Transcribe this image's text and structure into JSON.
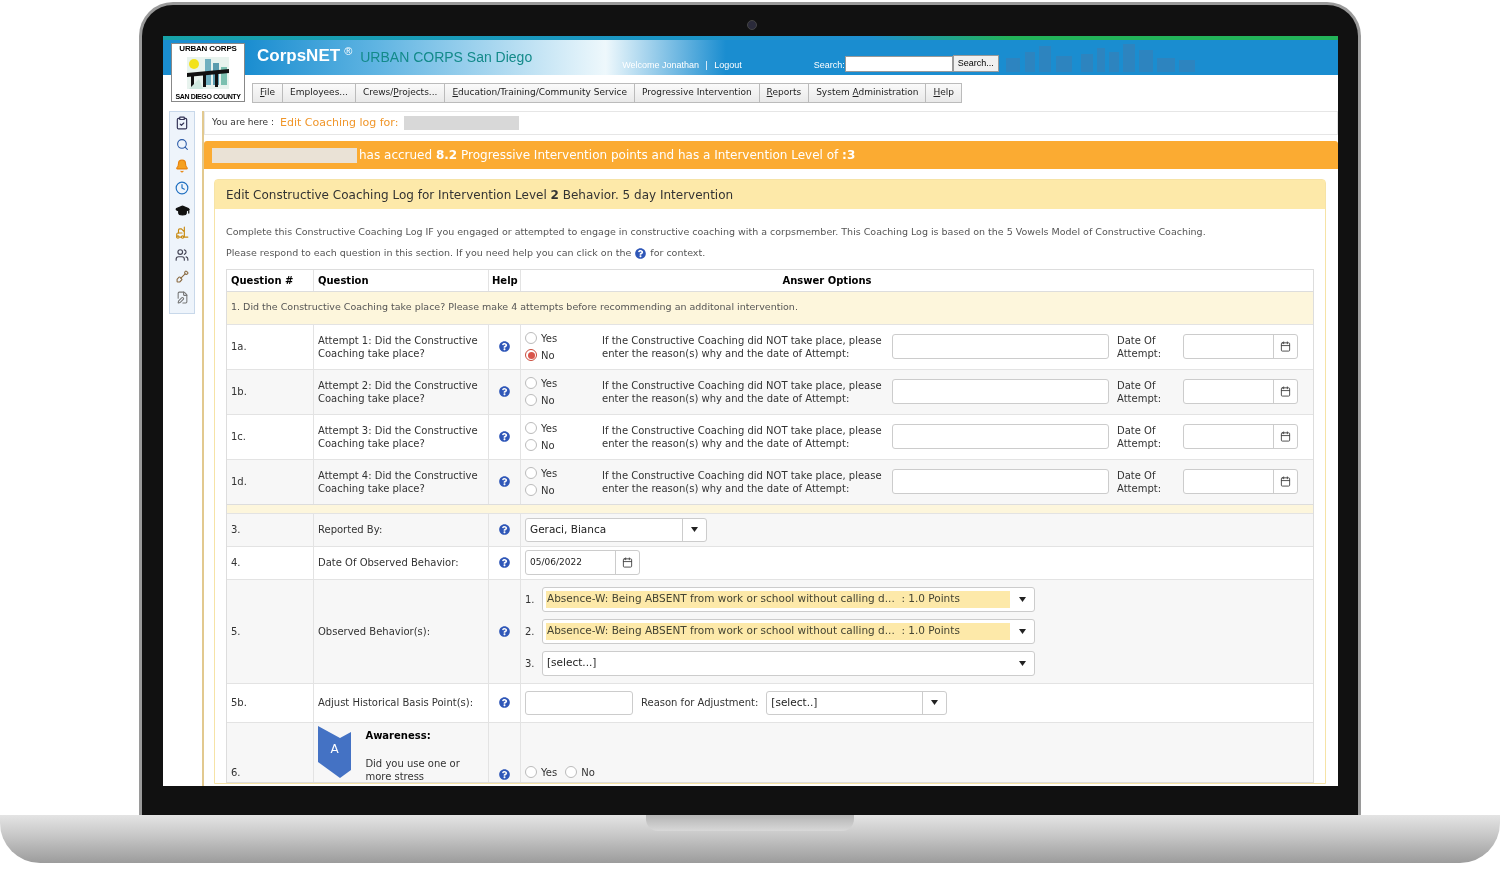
{
  "header": {
    "app_name": "CorpsNET",
    "registered": "®",
    "org": "URBAN CORPS San Diego",
    "welcome": "Welcome Jonathan",
    "separator": "|",
    "logout": "Logout",
    "search_label": "Search:",
    "search_button": "Search..."
  },
  "logo": {
    "top": "URBAN CORPS",
    "bottom": "SAN DIEGO COUNTY"
  },
  "menu": [
    {
      "key": "F",
      "after": "ile"
    },
    {
      "before": "Employees..."
    },
    {
      "before": "Crews/",
      "key": "P",
      "after": "rojects..."
    },
    {
      "key": "E",
      "after": "ducation/Training/Community Service"
    },
    {
      "before": "Progressive Intervention"
    },
    {
      "key": "R",
      "after": "eports"
    },
    {
      "before": "System ",
      "key": "A",
      "after": "dministration"
    },
    {
      "key": "H",
      "after": "elp"
    }
  ],
  "breadcrumb": {
    "label": "You are here :",
    "current": "Edit Coaching log for:"
  },
  "banner": "has accrued **8.2** Progressive Intervention points and has a Intervention Level of **:3**",
  "panel": {
    "title": "Edit Constructive Coaching Log for Intervention Level **2** Behavior. 5 day Intervention",
    "intro": "Complete this Constructive Coaching Log IF you engaged or attempted to engage in constructive coaching with a corpsmember. This Coaching Log is based on the 5 Vowels Model of Constructive Coaching.",
    "help_before": "Please respond to each question in this section. If you need help you can click on the",
    "help_after": "for context."
  },
  "table": {
    "columns": [
      "Question #",
      "Question",
      "Help",
      "Answer Options"
    ],
    "section": "1. Did the Constructive Coaching take place? Please make 4 attempts before recommending an additonal intervention.",
    "attempts": [
      {
        "num": "1a.",
        "question": "Attempt 1: Did the Constructive Coaching take place?",
        "options": [
          {
            "label": "Yes",
            "selected": false
          },
          {
            "label": "No",
            "selected": true
          }
        ],
        "prompt": "If the Constructive Coaching did NOT take place, please enter the reason(s) why and the date of Attempt:",
        "date_label": "Date Of Attempt:"
      },
      {
        "num": "1b.",
        "question": "Attempt 2: Did the Constructive Coaching take place?",
        "options": [
          {
            "label": "Yes",
            "selected": false
          },
          {
            "label": "No",
            "selected": false
          }
        ],
        "prompt": "If the Constructive Coaching did NOT take place, please enter the reason(s) why and the date of Attempt:",
        "date_label": "Date Of Attempt:"
      },
      {
        "num": "1c.",
        "question": "Attempt 3: Did the Constructive Coaching take place?",
        "options": [
          {
            "label": "Yes",
            "selected": false
          },
          {
            "label": "No",
            "selected": false
          }
        ],
        "prompt": "If the Constructive Coaching did NOT take place, please enter the reason(s) why and the date of Attempt:",
        "date_label": "Date Of Attempt:"
      },
      {
        "num": "1d.",
        "question": "Attempt 4: Did the Constructive Coaching take place?",
        "options": [
          {
            "label": "Yes",
            "selected": false
          },
          {
            "label": "No",
            "selected": false
          }
        ],
        "prompt": "If the Constructive Coaching did NOT take place, please enter the reason(s) why and the date of Attempt:",
        "date_label": "Date Of Attempt:"
      }
    ],
    "reported_by": {
      "num": "3.",
      "question": "Reported By:",
      "value": "Geraci, Bianca"
    },
    "date_observed": {
      "num": "4.",
      "question": "Date Of Observed Behavior:",
      "value": "05/06/2022"
    },
    "behaviors": {
      "num": "5.",
      "question": "Observed Behavior(s):",
      "items": [
        {
          "index": "1.",
          "value": "Absence-W: Being ABSENT from work or school without calling d...  : 1.0 Points",
          "highlighted": true
        },
        {
          "index": "2.",
          "value": "Absence-W: Being ABSENT from work or school without calling d...  : 1.0 Points",
          "highlighted": true
        },
        {
          "index": "3.",
          "value": "[select...]",
          "highlighted": false
        }
      ]
    },
    "adjust": {
      "num": "5b.",
      "question": "Adjust Historical Basis Point(s):",
      "reason_label": "Reason for Adjustment:",
      "reason_value": "[select..]"
    },
    "awareness": {
      "num": "6.",
      "badge": "A",
      "title": "Awareness:",
      "question": "Did you use one or more stress",
      "options": [
        {
          "label": "Yes",
          "selected": false
        },
        {
          "label": "No",
          "selected": false
        }
      ]
    }
  }
}
